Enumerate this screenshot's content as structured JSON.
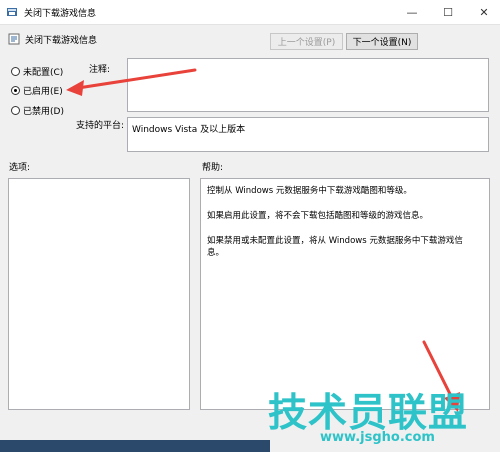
{
  "window": {
    "title": "关闭下载游戏信息",
    "controls": {
      "minimize": "—",
      "maximize": "☐",
      "close": "✕"
    }
  },
  "header": {
    "policy_name": "关闭下载游戏信息",
    "prev_button": "上一个设置(P)",
    "next_button": "下一个设置(N)"
  },
  "options": {
    "not_configured": "未配置(C)",
    "enabled": "已启用(E)",
    "disabled": "已禁用(D)",
    "selected": "enabled"
  },
  "labels": {
    "note": "注释:",
    "platform": "支持的平台:",
    "options_section": "选项:",
    "help_section": "帮助:"
  },
  "platform_value": "Windows Vista 及以上版本",
  "note_value": "",
  "help_text": [
    "控制从 Windows 元数据服务中下载游戏酷图和等级。",
    "如果启用此设置，将不会下载包括酷图和等级的游戏信息。",
    "如果禁用或未配置此设置，将从 Windows 元数据服务中下载游戏信息。"
  ],
  "watermark": {
    "logo": "技术员联盟",
    "url": "www.jsgho.com"
  },
  "colors": {
    "window_bg": "#f0f0f0",
    "annotation_arrow": "#e8423a",
    "watermark": "#2dc3c8"
  }
}
